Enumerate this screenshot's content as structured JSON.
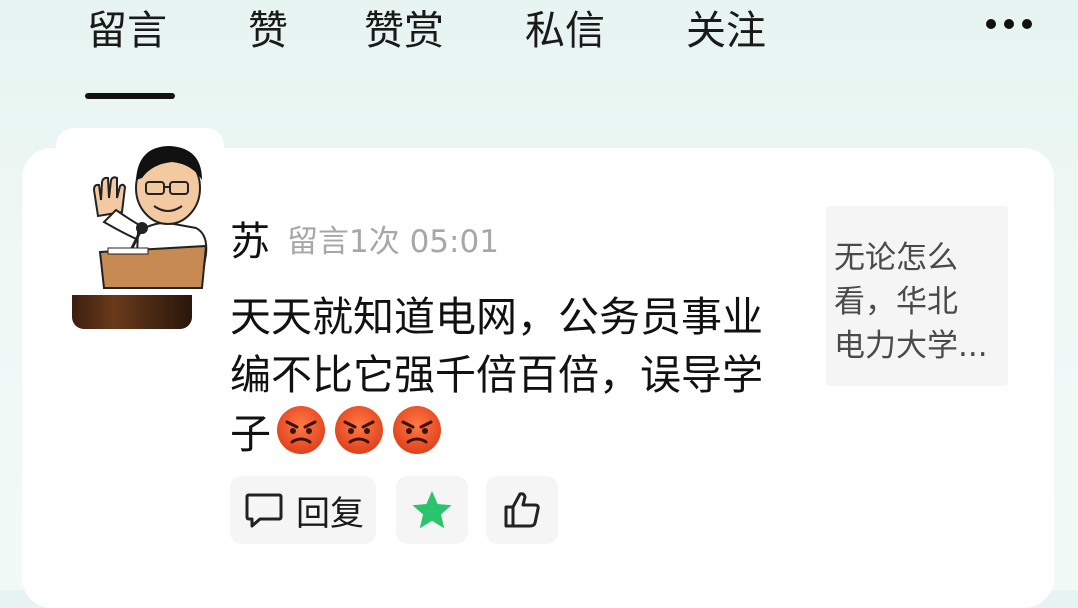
{
  "tabs": [
    {
      "label": "留言",
      "active": true
    },
    {
      "label": "赞"
    },
    {
      "label": "赞赏"
    },
    {
      "label": "私信"
    },
    {
      "label": "关注"
    }
  ],
  "more_icon": "more-dots-icon",
  "comment": {
    "username": "苏",
    "meta": "留言1次 05:01",
    "text": "天天就知道电网，公务员事业编不比它强千倍百倍，误导学子",
    "emojis": [
      "angry-face-icon",
      "angry-face-icon",
      "angry-face-icon"
    ],
    "actions": {
      "reply_label": "回复",
      "star_icon": "star-icon",
      "star_color": "#2bc46c",
      "like_icon": "thumbs-up-icon"
    }
  },
  "preview": {
    "line1": "无论怎么",
    "line2": "看，华北",
    "line3": "电力大学..."
  }
}
